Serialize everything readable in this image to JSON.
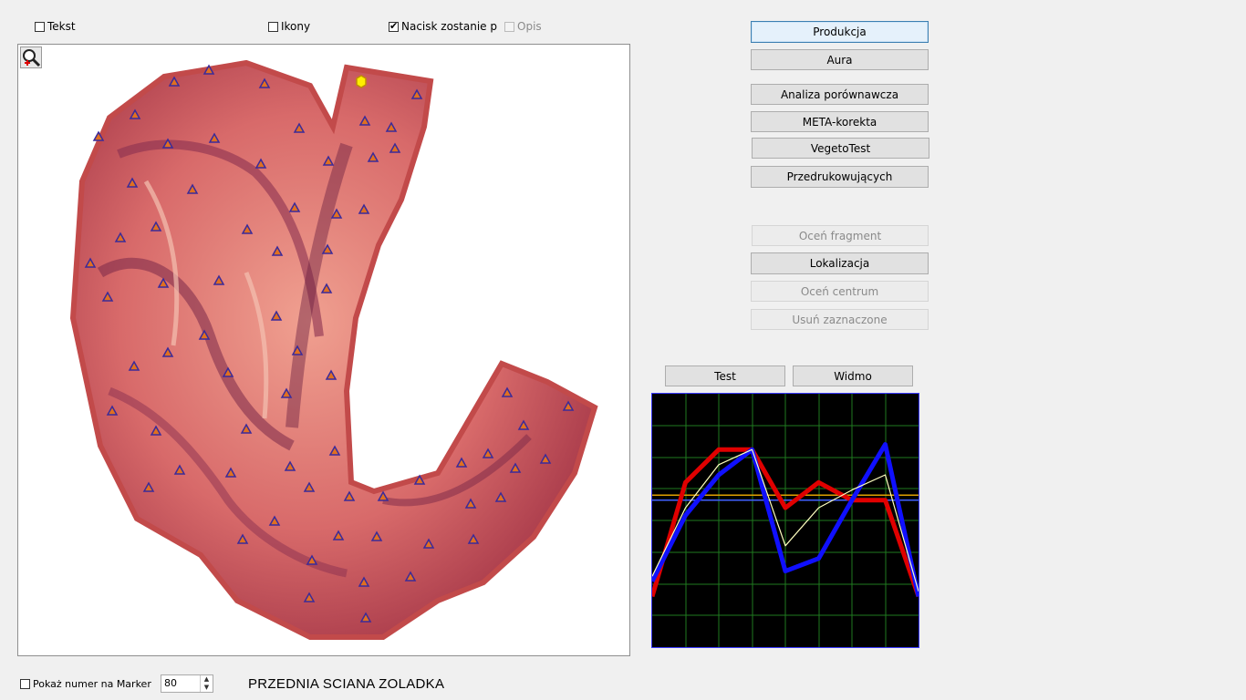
{
  "checkboxes": {
    "tekst": {
      "label": "Tekst",
      "checked": false
    },
    "ikony": {
      "label": "Ikony",
      "checked": false
    },
    "nacisk": {
      "label": "Nacisk zostanie p",
      "checked": true
    },
    "opis": {
      "label": "Opis",
      "checked": false,
      "disabled": true
    },
    "pokaz_numer": {
      "label": "Pokaż numer na Marker",
      "checked": false
    }
  },
  "buttons": {
    "produkcja": "Produkcja",
    "aura": "Aura",
    "analiza": "Analiza porównawcza",
    "meta": "META-korekta",
    "vegeto": "VegetoTest",
    "przedruk": "Przedrukowujących",
    "ocen_fragment": "Oceń fragment",
    "lokalizacja": "Lokalizacja",
    "ocen_centrum": "Oceń centrum",
    "usun": "Usuń zaznaczone",
    "test": "Test",
    "widmo": "Widmo"
  },
  "spinner": {
    "value": "80"
  },
  "organ_title": "PRZEDNIA SCIANA ZOLADKA",
  "icons": {
    "zoom": "magnifier-zoom-icon",
    "marker": "triangle-marker-icon",
    "selected_marker": "yellow-hexagon-marker-icon"
  },
  "colors": {
    "marker_fill": "#e07020",
    "marker_stroke": "#3a2a9a",
    "tissue": "#d86a6a",
    "graph_bg": "#000000",
    "grid": "#1f7a1f"
  },
  "chart_data": {
    "type": "line",
    "title": "",
    "grid": true,
    "series": [
      {
        "color": "#e00000",
        "values": [
          20,
          65,
          78,
          78,
          55,
          65,
          58,
          58,
          20
        ]
      },
      {
        "color": "#1010ff",
        "values": [
          26,
          52,
          68,
          78,
          30,
          35,
          58,
          80,
          20
        ]
      },
      {
        "color": "#ffffc0",
        "values": [
          28,
          55,
          72,
          78,
          40,
          55,
          62,
          68,
          22
        ]
      }
    ],
    "reference_lines": [
      {
        "color": "#e0a000",
        "value": 60
      },
      {
        "color": "#4060ff",
        "value": 58
      }
    ]
  }
}
